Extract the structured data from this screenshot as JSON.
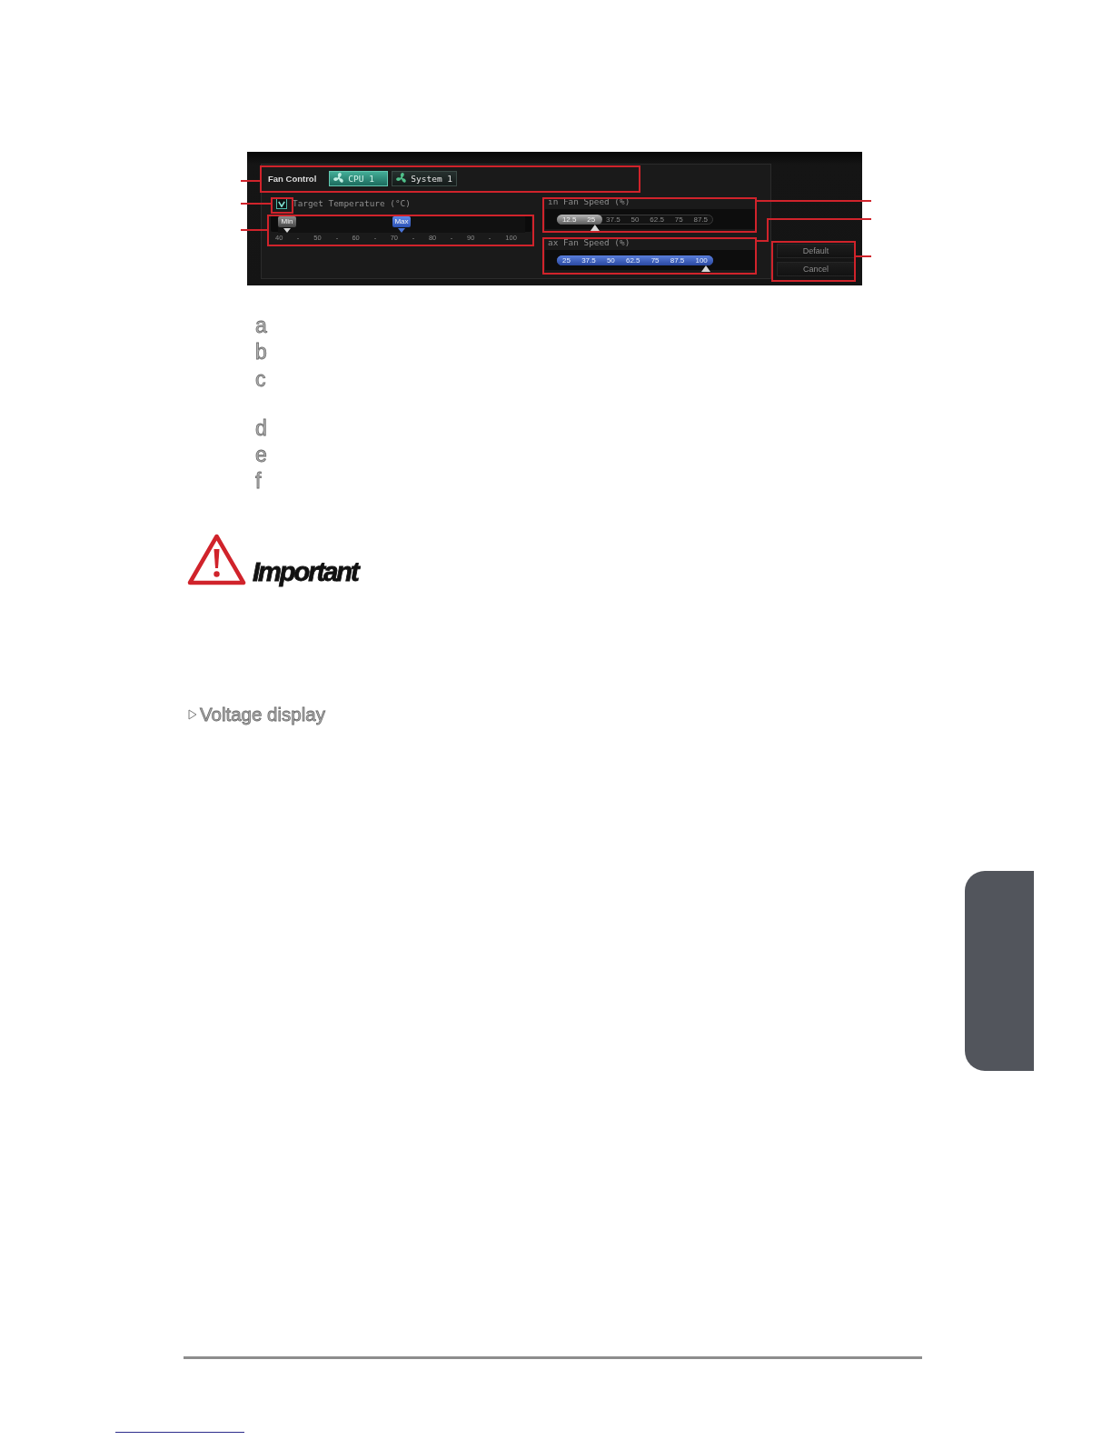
{
  "fan_control": {
    "title": "Fan Control",
    "tabs": [
      {
        "label": "CPU 1",
        "selected": true
      },
      {
        "label": "System 1",
        "selected": false
      }
    ]
  },
  "target_temperature": {
    "label": "Target Temperature (°C)",
    "checked": true,
    "markers": [
      {
        "label": "Min",
        "kind": "min",
        "level": 0
      },
      {
        "label": "Max",
        "kind": "max",
        "level": 0.5
      }
    ],
    "ticks": [
      "40",
      "50",
      "60",
      "70",
      "80",
      "90",
      "100"
    ]
  },
  "min_fan_speed": {
    "label": "in Fan Speed (%)",
    "level": 0.29,
    "steps": [
      "12.5",
      "25",
      "37.5",
      "50",
      "62.5",
      "75",
      "87.5"
    ]
  },
  "max_fan_speed": {
    "label": "ax Fan Speed (%)",
    "level": 1,
    "steps": [
      "25",
      "37.5",
      "50",
      "62.5",
      "75",
      "87.5",
      "100"
    ]
  },
  "buttons": [
    "Default",
    "Cancel"
  ],
  "legend": [
    "a",
    "b",
    "c",
    "d",
    "e",
    "f"
  ],
  "important": {
    "title": "Important"
  },
  "section": {
    "heading": "Voltage display"
  }
}
